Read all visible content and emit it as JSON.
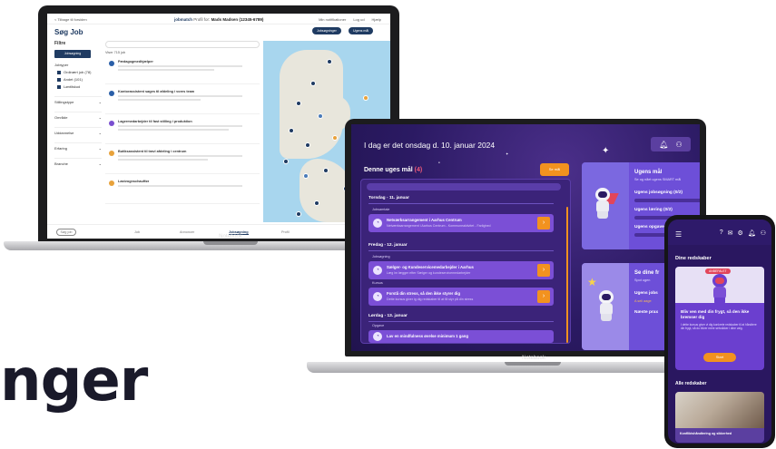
{
  "big_text": "nger",
  "laptop1": {
    "back_link": "< Tilbage til forsiden",
    "brand": "jobmatch",
    "profile_prefix": "Profil for:",
    "profile_name": "Mads Madsen (12345-6789)",
    "top_actions": [
      "Min notifikationer",
      "Log ud",
      "Hjælp"
    ],
    "heading": "Søg Job",
    "header_buttons": [
      "Jobsøgninger",
      "Ugens mål"
    ],
    "filter_title": "Filtre",
    "save_button": "Jobsøgning",
    "filter_group": "Jobtyper",
    "filter_checks": [
      "Ordinært job (78)",
      "Andet (101)",
      "Løntilskud"
    ],
    "filter_sections": [
      "Stillingstype",
      "Område",
      "Uddannelse",
      "Erfaring",
      "Branche"
    ],
    "result_count": "Viser 715 job",
    "jobs": [
      {
        "title": "Pædagogmedhjælper"
      },
      {
        "title": "Kontorassistent søges til afdeling i vores team"
      },
      {
        "title": "Lagermedarbejder til fast stilling i produktion"
      },
      {
        "title": "Butiksassistent til travl afdeling i centrum"
      },
      {
        "title": "Lastvognschauffør"
      }
    ],
    "bottom_tabs": [
      "Søg job",
      "Job",
      "Annoncer",
      "Jobsøgning",
      "Profil"
    ],
    "bottom_pill": "Søg job",
    "brand_color": "#1f3b62"
  },
  "laptop2": {
    "date": "I dag er det onsdag d. 10. januar 2024",
    "goal_title": "Denne uges mål",
    "goal_count": "(4)",
    "goal_button": "Se mål",
    "days": [
      {
        "label": "Torsdag - 11. januar",
        "tasks": [
          {
            "category": "Jobsamtale",
            "title": "Netværksarrangement i Aarhus Centrum",
            "sub": "Netværksarrangement i Aarhus Centrum - Kommuneaktivitet - Farlighed"
          }
        ]
      },
      {
        "label": "Fredag - 12. januar",
        "tasks": [
          {
            "category": "Jobsøgning",
            "title": "Sælger- og Kundeservicemedarbejder i Aarhus",
            "sub": "Læg lm lægger efter Sælger og kundeservicemedarbejder"
          },
          {
            "category": "Kursus",
            "title": "Forstå din stress, så den ikke styrer dig",
            "sub": "Dette kursus giver ig dig redskaber til at få styr på din stress"
          }
        ]
      },
      {
        "label": "Lørdag - 13. januar",
        "tasks": [
          {
            "category": "Opgave",
            "title": "Lav en mindfulness øvelse minimum 1 gang",
            "sub": ""
          }
        ]
      }
    ],
    "right_card1": {
      "title": "Ugens mål",
      "sub": "Se og nået ugens SMART mål",
      "items": [
        "Ugens jobsøgning (0/2)",
        "Ugens læring (0/2)",
        "Ugens opgaver"
      ]
    },
    "right_card2": {
      "title": "Se dine fr",
      "sub": "Spot ugen",
      "items": [
        "Ugens jobs",
        "Næste prax"
      ],
      "link": "A seli aage"
    },
    "background_color": "#2b1a63",
    "accent_color": "#f2921f"
  },
  "phone": {
    "section_title": "Dine redskaber",
    "card_badge": "ANBEFALET",
    "card_heading": "Bliv ven med din frygt, så den ikke bremser dig",
    "card_desc": "I dette kursus giver vi dig konkrete redskaber til at håndtere din frygt, så du bliver mere selvsikker i dine valg.",
    "card_button": "Start",
    "all_title": "Alle redskaber",
    "card2_caption": "Konfliktshåndtering og sikkerhed"
  },
  "notebook_labels": [
    "Notebook",
    "Notebook"
  ],
  "icons": [
    "menu-icon",
    "help-icon",
    "mail-icon",
    "settings-icon",
    "bell-icon",
    "user-icon",
    "arrow-right-icon"
  ]
}
